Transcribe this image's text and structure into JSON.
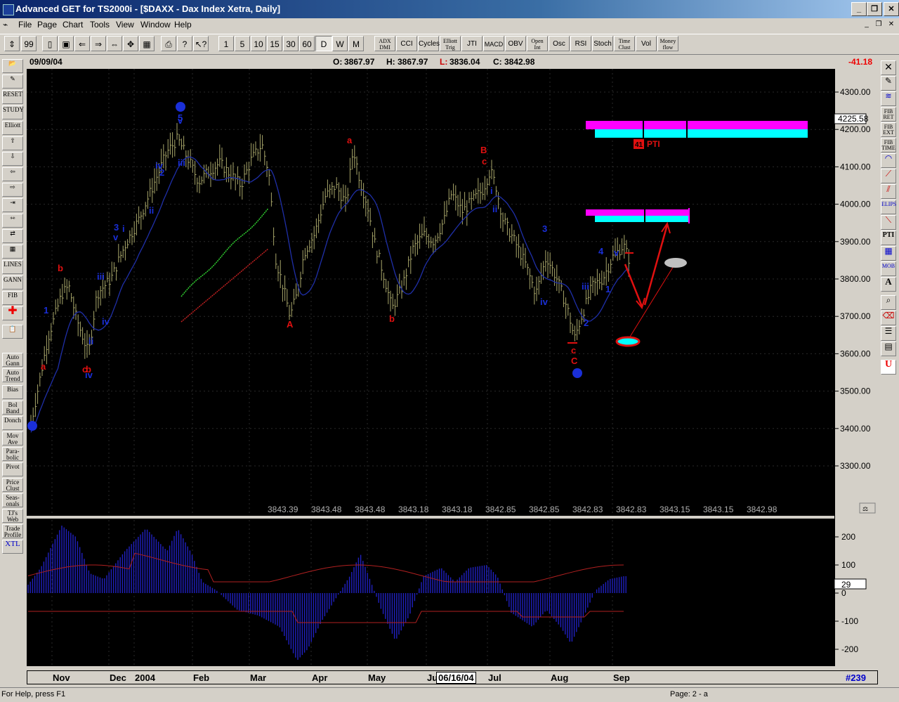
{
  "window": {
    "title": "Advanced GET for TS2000i - [$DAXX - Dax Index Xetra, Daily]"
  },
  "menu": [
    "File",
    "Page",
    "Chart",
    "Tools",
    "View",
    "Window",
    "Help"
  ],
  "toolbar": {
    "intervals": [
      "1",
      "5",
      "10",
      "15",
      "30",
      "60",
      "D",
      "W",
      "M"
    ],
    "selected_interval": "D",
    "studies": [
      "ADX DMI",
      "CCI",
      "Cycles",
      "Elliott Trig",
      "JTI",
      "MACD",
      "OBV",
      "Open Int",
      "Osc",
      "RSI",
      "Stoch",
      "Time Clust",
      "Vol",
      "Money flow"
    ]
  },
  "left_toolbar": [
    "RESET",
    "STUDY",
    "Elliott",
    "LINES",
    "GANN",
    "FIB",
    "Auto Gann",
    "Auto Trend",
    "Bias",
    "Bol Band",
    "Donch",
    "Mov Ave",
    "Para-bolic",
    "Pivot",
    "Price Clust",
    "Seas-onals",
    "TJ's Web",
    "Trade Profile",
    "XTL"
  ],
  "right_toolbar": [
    "FIB RET",
    "FIB EXT",
    "FIB TIME",
    "ELIPS",
    "PTI",
    "MOB"
  ],
  "info": {
    "date": "09/09/04",
    "open_label": "O:",
    "open": "3867.97",
    "high_label": "H:",
    "high": "3867.97",
    "low_label": "L:",
    "low": "3836.04",
    "close_label": "C:",
    "close": "3842.98",
    "change": "-41.18"
  },
  "colors": {
    "bars": "#a8a66a",
    "ma": "#1f2fa8",
    "elliott_blue": "#1a2fd8",
    "elliott_red": "#e01010",
    "magenta": "#ff00ff",
    "cyan": "#00ffff",
    "osc": "#2020c0"
  },
  "price_axis": {
    "ticks": [
      "4300.00",
      "4200.00",
      "4100.00",
      "4000.00",
      "3900.00",
      "3800.00",
      "3700.00",
      "3600.00",
      "3500.00",
      "3400.00",
      "3300.00"
    ],
    "current": "4225.58"
  },
  "bottom_values": [
    "3843.39",
    "3843.48",
    "3843.48",
    "3843.18",
    "3843.18",
    "3842.85",
    "3842.85",
    "3842.83",
    "3842.83",
    "3843.15",
    "3843.15",
    "3842.98"
  ],
  "osc_axis": {
    "ticks": [
      "200",
      "100",
      "0",
      "-100",
      "-200"
    ],
    "current": "29"
  },
  "pti": {
    "value": "41",
    "label": "PTI"
  },
  "time_axis": {
    "labels": [
      "Nov",
      "Dec",
      "2004",
      "Feb",
      "Mar",
      "Apr",
      "May",
      "Jun",
      "Jul",
      "Aug",
      "Sep"
    ],
    "cursor_date": "06/16/04",
    "bar_count": "#239"
  },
  "wave_labels": {
    "blue": [
      "2",
      "5",
      "v",
      "1",
      "3",
      "v",
      "i",
      "iii",
      "iv",
      "ii",
      "iv",
      "2",
      "iii",
      "iv",
      "ii",
      "i",
      "ii",
      "iv",
      "3",
      "4",
      "1",
      "2",
      "iii",
      "v"
    ],
    "red": [
      "a",
      "b",
      "c",
      "A",
      "a",
      "b",
      "B",
      "c",
      "C",
      "b",
      "c"
    ]
  },
  "status": {
    "help": "For Help, press F1",
    "page": "Page: 2 - a"
  }
}
